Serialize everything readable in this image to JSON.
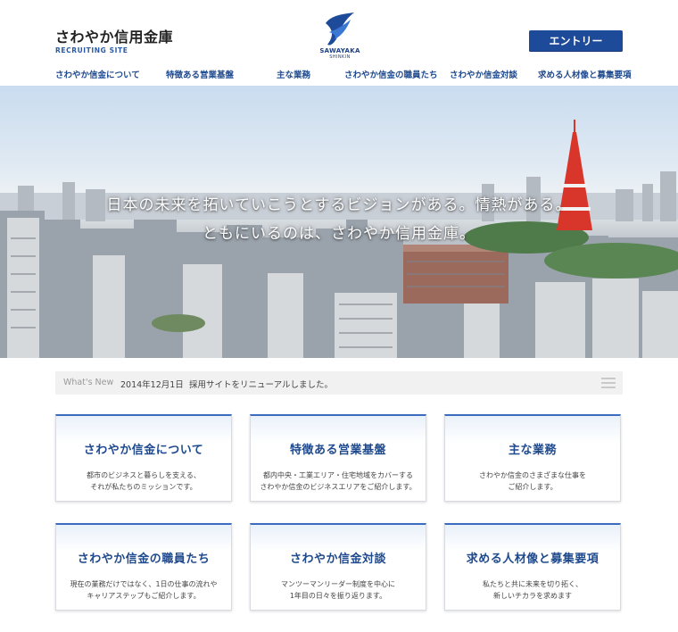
{
  "brand": {
    "name": "さわやか信用金庫",
    "sub": "RECRUITING SITE"
  },
  "logo": {
    "line1": "SAWAYAKA",
    "line2": "SHINKIN"
  },
  "header": {
    "entry_label": "エントリー"
  },
  "nav": [
    {
      "label": "さわやか信金について"
    },
    {
      "label": "特徴ある営業基盤"
    },
    {
      "label": "主な業務"
    },
    {
      "label": "さわやか信金の職員たち"
    },
    {
      "label": "さわやか信金対談"
    },
    {
      "label": "求める人材像と募集要項"
    }
  ],
  "hero": {
    "line1": "日本の未来を拓いていこうとするビジョンがある。情熱がある。",
    "line2": "ともにいるのは、さわやか信用金庫。"
  },
  "news": {
    "label": "What's New",
    "date": "2014年12月1日",
    "text": "採用サイトをリニューアルしました。"
  },
  "cards": [
    {
      "title": "さわやか信金について",
      "desc1": "都市のビジネスと暮らしを支える、",
      "desc2": "それが私たちのミッションです。"
    },
    {
      "title": "特徴ある営業基盤",
      "desc1": "都内中央・工業エリア・住宅地域をカバーする",
      "desc2": "さわやか信金のビジネスエリアをご紹介します。"
    },
    {
      "title": "主な業務",
      "desc1": "さわやか信金のさまざまな仕事を",
      "desc2": "ご紹介します。"
    },
    {
      "title": "さわやか信金の職員たち",
      "desc1": "現在の業務だけではなく、1日の仕事の流れや",
      "desc2": "キャリアステップもご紹介します。"
    },
    {
      "title": "さわやか信金対談",
      "desc1": "マンツーマンリーダー制度を中心に",
      "desc2": "1年目の日々を振り返ります。"
    },
    {
      "title": "求める人材像と募集要項",
      "desc1": "私たちと共に未来を切り拓く、",
      "desc2": "新しいチカラを求めます"
    }
  ],
  "colors": {
    "brand_blue": "#1d4a99",
    "nav_text": "#1f4a8e",
    "card_accent": "#3b6cc0"
  }
}
